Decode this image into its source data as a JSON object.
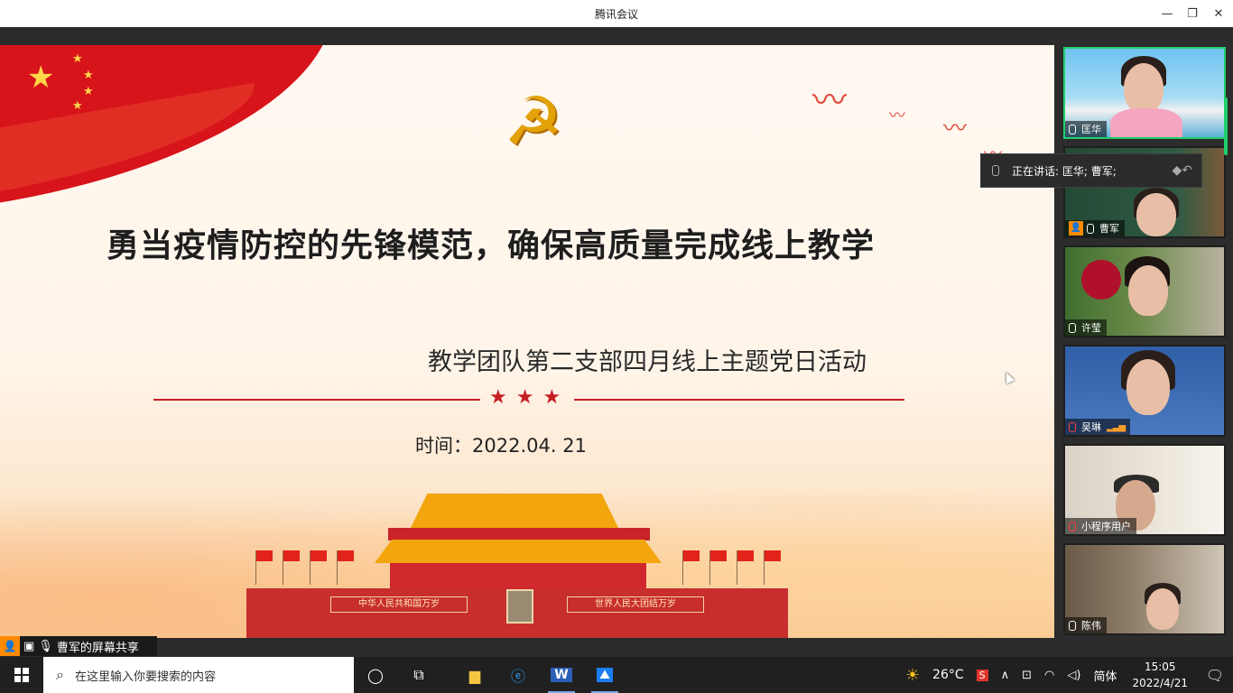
{
  "window": {
    "title": "腾讯会议",
    "controls": [
      "—",
      "❐",
      "✕"
    ]
  },
  "slide": {
    "title": "勇当疫情防控的先锋模范，确保高质量完成线上教学",
    "subtitle": "教学团队第二支部四月线上主题党日活动",
    "time": "时间：2022.04. 21",
    "banner_left": "中华人民共和国万岁",
    "banner_right": "世界人民大团结万岁"
  },
  "share_badge": {
    "label": "曹军的屏幕共享"
  },
  "speaking": {
    "text": "正在讲话: 匡华; 曹军;"
  },
  "participants": [
    {
      "name": "匡华",
      "active": true,
      "host": false,
      "muted": false
    },
    {
      "name": "曹军",
      "active": false,
      "host": true,
      "muted": false
    },
    {
      "name": "许莹",
      "active": false,
      "host": false,
      "muted": false
    },
    {
      "name": "吴琳",
      "active": false,
      "host": false,
      "muted": true
    },
    {
      "name": "小程序用户",
      "active": false,
      "host": false,
      "muted": true
    },
    {
      "name": "陈伟",
      "active": false,
      "host": false,
      "muted": false
    }
  ],
  "taskbar": {
    "search_placeholder": "在这里输入你要搜索的内容",
    "weather": "26°C",
    "ime": "简体",
    "time": "15:05",
    "date": "2022/4/21"
  },
  "colors": {
    "accent_green": "#1fd06a",
    "host_orange": "#ff8a00",
    "party_red": "#c51e22"
  }
}
